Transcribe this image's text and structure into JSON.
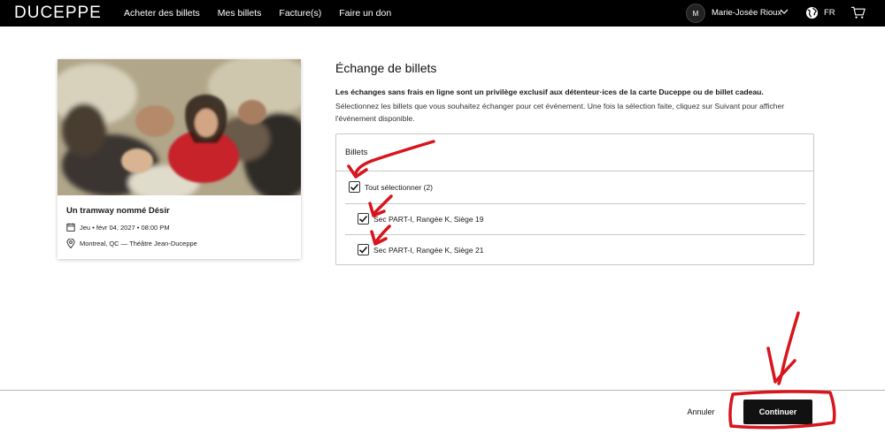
{
  "header": {
    "logo": "DUCEPPE",
    "nav": [
      "Acheter des billets",
      "Mes billets",
      "Facture(s)",
      "Faire un don"
    ],
    "avatar_initial": "M",
    "username": "Marie-Josée Rioux",
    "language": "FR"
  },
  "event": {
    "title": "Un tramway nommé Désir",
    "date": "Jeu • févr 04, 2027 • 08:00 PM",
    "location": "Montreal, QC — Théâtre Jean-Duceppe"
  },
  "exchange": {
    "title": "Échange de billets",
    "intro_bold": "Les échanges sans frais en ligne sont un privilège exclusif aux détenteur·ices de la carte Duceppe ou de billet cadeau.",
    "intro": "Sélectionnez les billets que vous souhaitez échanger pour cet événement. Une fois la sélection faite, cliquez sur Suivant pour afficher l'événement disponible.",
    "tickets_heading": "Billets",
    "select_all": {
      "label": "Tout sélectionner (2)",
      "checked": true
    },
    "tickets": [
      {
        "label": "Sec PART-I, Rangée K, Siège 19",
        "checked": true
      },
      {
        "label": "Sec PART-I, Rangée K, Siège 21",
        "checked": true
      }
    ]
  },
  "footer": {
    "cancel_label": "Annuler",
    "continue_label": "Continuer"
  },
  "colors": {
    "topbar": "#000000",
    "primary_button": "#111111",
    "annotation_red": "#d8141c"
  }
}
